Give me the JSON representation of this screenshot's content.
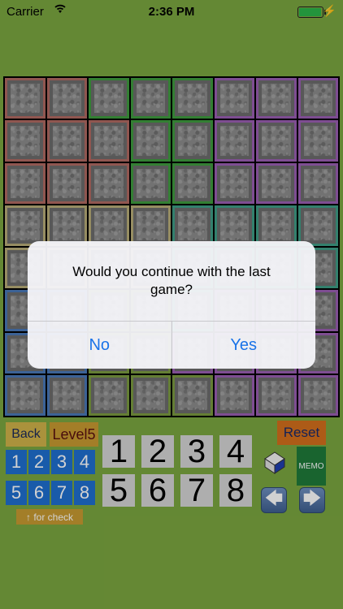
{
  "status_bar": {
    "carrier": "Carrier",
    "time": "2:36 PM",
    "wifi_icon": "wifi-icon",
    "battery_level": 0.95
  },
  "board": {
    "rows": 8,
    "cols": 8,
    "colors": {
      "red": "#b06a62",
      "green": "#3f9b3f",
      "purple": "#9a5fb3",
      "khaki": "#b8ad78",
      "teal": "#3f9d86",
      "blue": "#4a78b8",
      "olive": "#7a9a40"
    },
    "regions": [
      [
        "red",
        "red",
        "green",
        "green",
        "green",
        "purple",
        "purple",
        "purple"
      ],
      [
        "red",
        "red",
        "red",
        "green",
        "green",
        "purple",
        "purple",
        "purple"
      ],
      [
        "red",
        "red",
        "red",
        "green",
        "green",
        "purple",
        "purple",
        "purple"
      ],
      [
        "khaki",
        "khaki",
        "khaki",
        "khaki",
        "teal",
        "teal",
        "teal",
        "teal"
      ],
      [
        "khaki",
        "khaki",
        "khaki",
        "khaki",
        "teal",
        "teal",
        "teal",
        "teal"
      ],
      [
        "blue",
        "blue",
        "olive",
        "olive",
        "teal",
        "purple",
        "purple",
        "purple"
      ],
      [
        "blue",
        "blue",
        "olive",
        "olive",
        "purple",
        "purple",
        "purple",
        "purple"
      ],
      [
        "blue",
        "blue",
        "olive",
        "olive",
        "olive",
        "purple",
        "purple",
        "purple"
      ]
    ]
  },
  "dialog": {
    "message": "Would you continue with the last game?",
    "no_label": "No",
    "yes_label": "Yes"
  },
  "controls": {
    "back_label": "Back",
    "level_label": "Level5",
    "small_digits": [
      "1",
      "2",
      "3",
      "4",
      "5",
      "6",
      "7",
      "8"
    ],
    "check_hint": "↑ for check",
    "big_digits": [
      "1",
      "2",
      "3",
      "4",
      "5",
      "6",
      "7",
      "8"
    ],
    "reset_label": "Reset",
    "memo_label": "MEMO",
    "left_arrow": "🡄",
    "right_arrow": "🡆"
  }
}
